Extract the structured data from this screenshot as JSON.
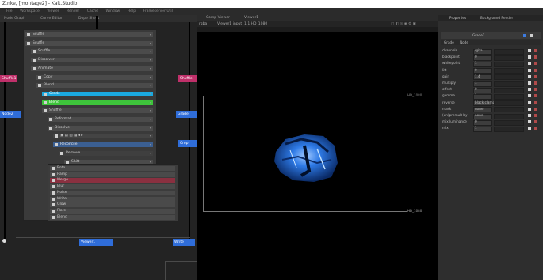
{
  "window": {
    "title": "Z.nke, [montage2] - Kalt.Studio"
  },
  "menubar": [
    "File",
    "Workspace",
    "Viewer",
    "Render",
    "Cache",
    "Window",
    "Help",
    "Frameserver Util"
  ],
  "graph": {
    "tabs": [
      "Node Graph",
      "Curve Editor",
      "Dope Sheet"
    ],
    "menu": [
      {
        "label": "Scuffle",
        "indent": 0,
        "style": "normal"
      },
      {
        "label": "Scuffle",
        "indent": 0,
        "style": "normal"
      },
      {
        "label": "Scuffle",
        "indent": 1,
        "style": "normal"
      },
      {
        "label": "Dissolver",
        "indent": 1,
        "style": "normal"
      },
      {
        "label": "Animate",
        "indent": 1,
        "style": "normal"
      },
      {
        "label": "Copy",
        "indent": 2,
        "style": "normal"
      },
      {
        "label": "Blend",
        "indent": 2,
        "style": "normal"
      },
      {
        "label": "Grade",
        "indent": 3,
        "style": "cyan"
      },
      {
        "label": "Blend",
        "indent": 3,
        "style": "green"
      },
      {
        "label": "Shuffle",
        "indent": 3,
        "style": "normal"
      },
      {
        "label": "Reformat",
        "indent": 4,
        "style": "normal"
      },
      {
        "label": "Dissolve",
        "indent": 4,
        "style": "normal"
      },
      {
        "label": "",
        "indent": 5,
        "style": "toolbar"
      },
      {
        "label": "Reconcile",
        "indent": 5,
        "style": "blue"
      },
      {
        "label": "Remove",
        "indent": 6,
        "style": "dark"
      },
      {
        "label": "Shift",
        "indent": 7,
        "style": "normal"
      },
      {
        "label": "Select",
        "indent": 7,
        "style": "normal"
      },
      {
        "label": "Crosser",
        "indent": 7,
        "style": "normal"
      },
      {
        "label": "Scale",
        "indent": 7,
        "style": "normal"
      },
      {
        "label": "Invert",
        "indent": 6,
        "style": "normal"
      }
    ],
    "menu2": [
      {
        "label": "Roto",
        "style": "normal"
      },
      {
        "label": "Ramp",
        "style": "normal"
      },
      {
        "label": "Merge",
        "style": "red"
      },
      {
        "label": "Blur",
        "style": "normal"
      },
      {
        "label": "Noise",
        "style": "normal"
      },
      {
        "label": "Write",
        "style": "normal"
      },
      {
        "label": "Glow",
        "style": "normal"
      },
      {
        "label": "Flare",
        "style": "normal"
      },
      {
        "label": "Blend",
        "style": "normal"
      }
    ],
    "nodes": {
      "left1": "Shuffle1",
      "left2": "Node2",
      "right1": "Shuffle",
      "right2": "Grade",
      "right3": "Crop",
      "bottom1": "Viewer1",
      "bottom2": "Write"
    }
  },
  "viewer": {
    "tabs": [
      "Comp Viewer",
      "Viewer1"
    ],
    "bar_left": "rgba",
    "bar_mid": "Viewer1 input",
    "bar_right": "1:1  HD_1080",
    "frame_label_tr": "HD_1080",
    "frame_label_br": "HD_1080"
  },
  "props": {
    "tabs": [
      "Properties",
      "Background Render"
    ],
    "node_name": "Grade1",
    "subtabs": [
      "Grade",
      "Node"
    ],
    "rows": [
      {
        "label": "channels",
        "value": "rgba"
      },
      {
        "label": "blackpoint",
        "value": "0"
      },
      {
        "label": "whitepoint",
        "value": "1"
      },
      {
        "label": "lift",
        "value": "0"
      },
      {
        "label": "gain",
        "value": "1.4"
      },
      {
        "label": "multiply",
        "value": "1"
      },
      {
        "label": "offset",
        "value": "0"
      },
      {
        "label": "gamma",
        "value": "1"
      },
      {
        "label": "reverse",
        "value": "black clamp"
      },
      {
        "label": "mask",
        "value": "none"
      },
      {
        "label": "(un)premult by",
        "value": "none"
      },
      {
        "label": "mix luminance",
        "value": "0"
      },
      {
        "label": "mix",
        "value": "1"
      }
    ]
  },
  "colors": {
    "cyan": "#1aa9e0",
    "green": "#3ec43b",
    "blue_node": "#2f6dd9",
    "pink_node": "#c0306a",
    "red_row": "#8a3040"
  }
}
